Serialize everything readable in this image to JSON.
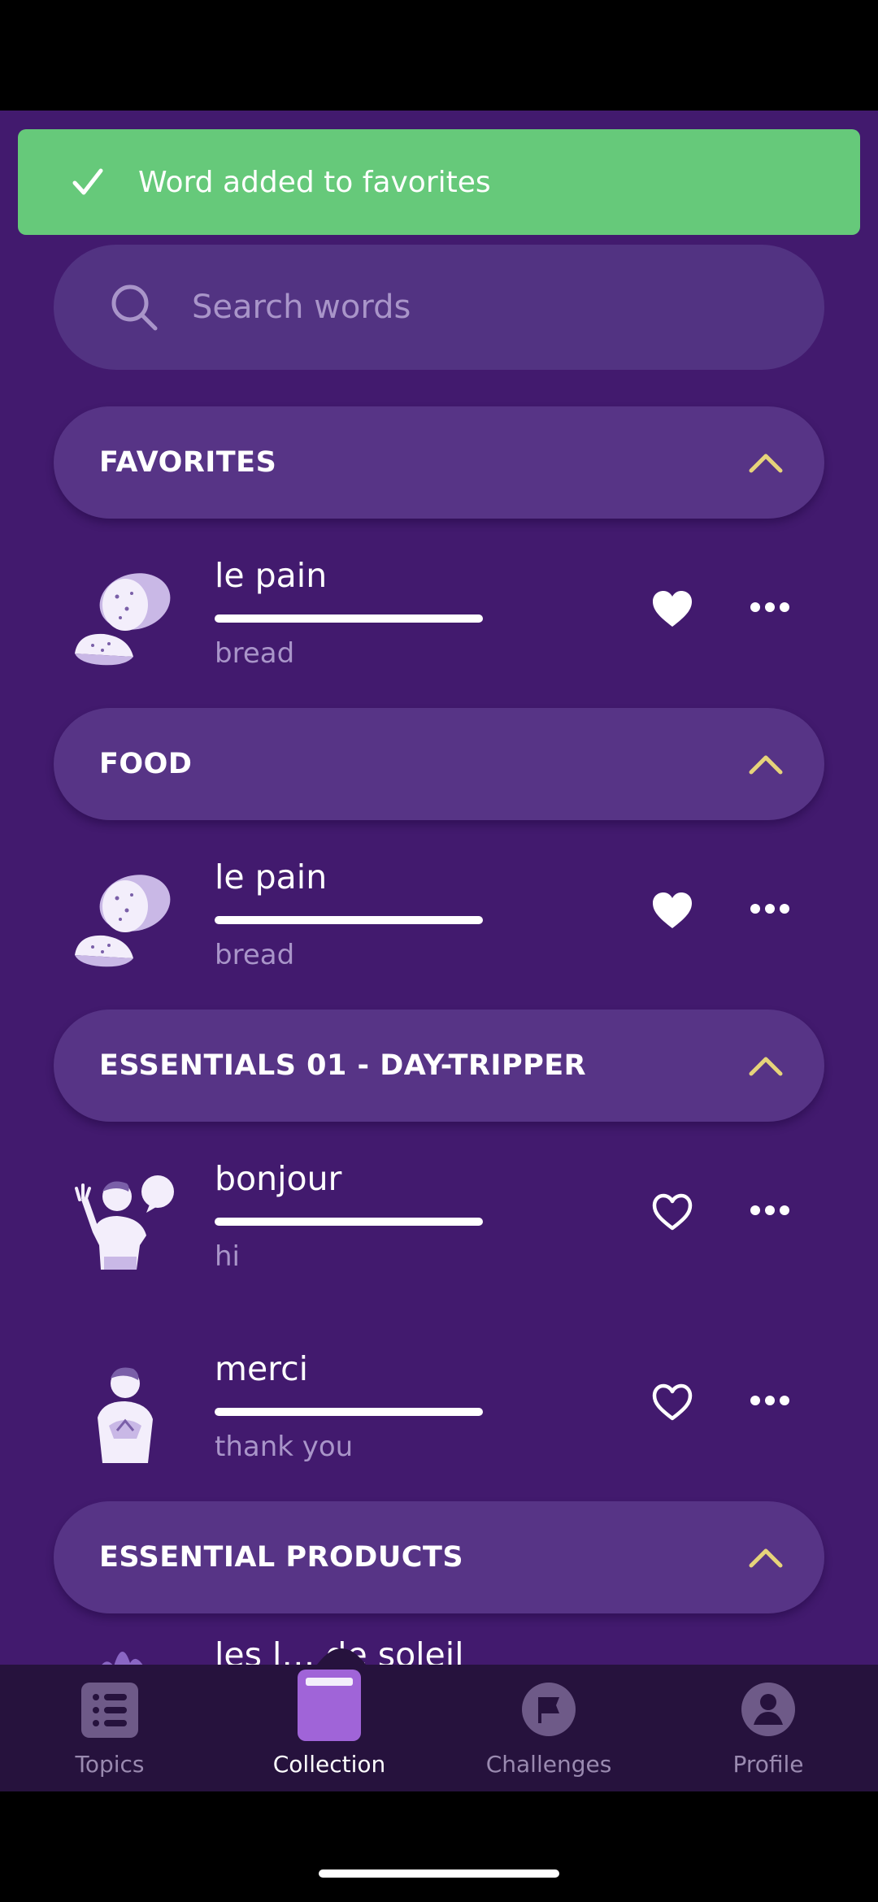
{
  "toast": {
    "message": "Word added to favorites",
    "color": "#66c97a"
  },
  "search": {
    "placeholder": "Search words"
  },
  "sections": [
    {
      "title": "FAVORITES",
      "words": [
        {
          "word": "le pain",
          "translation": "bread",
          "favorited": true,
          "image": "bread-icon"
        }
      ]
    },
    {
      "title": "FOOD",
      "words": [
        {
          "word": "le pain",
          "translation": "bread",
          "favorited": true,
          "image": "bread-icon"
        }
      ]
    },
    {
      "title": "ESSENTIALS 01 - DAY-TRIPPER",
      "words": [
        {
          "word": "bonjour",
          "translation": "hi",
          "favorited": false,
          "image": "waving-man-icon"
        },
        {
          "word": "merci",
          "translation": "thank you",
          "favorited": false,
          "image": "thankful-man-icon"
        }
      ]
    },
    {
      "title": "ESSENTIAL PRODUCTS",
      "words": [
        {
          "word": "les l… de soleil",
          "translation": "",
          "favorited": false,
          "image": "sun-product-icon"
        }
      ]
    }
  ],
  "nav": {
    "items": [
      {
        "label": "Topics",
        "icon": "list-icon",
        "active": false
      },
      {
        "label": "Collection",
        "icon": "book-icon",
        "active": true
      },
      {
        "label": "Challenges",
        "icon": "flag-icon",
        "active": false
      },
      {
        "label": "Profile",
        "icon": "profile-icon",
        "active": false
      }
    ]
  },
  "colors": {
    "background": "#421a6e",
    "section": "#573486",
    "accent": "#a064d8",
    "chevron": "#e6d37a"
  }
}
